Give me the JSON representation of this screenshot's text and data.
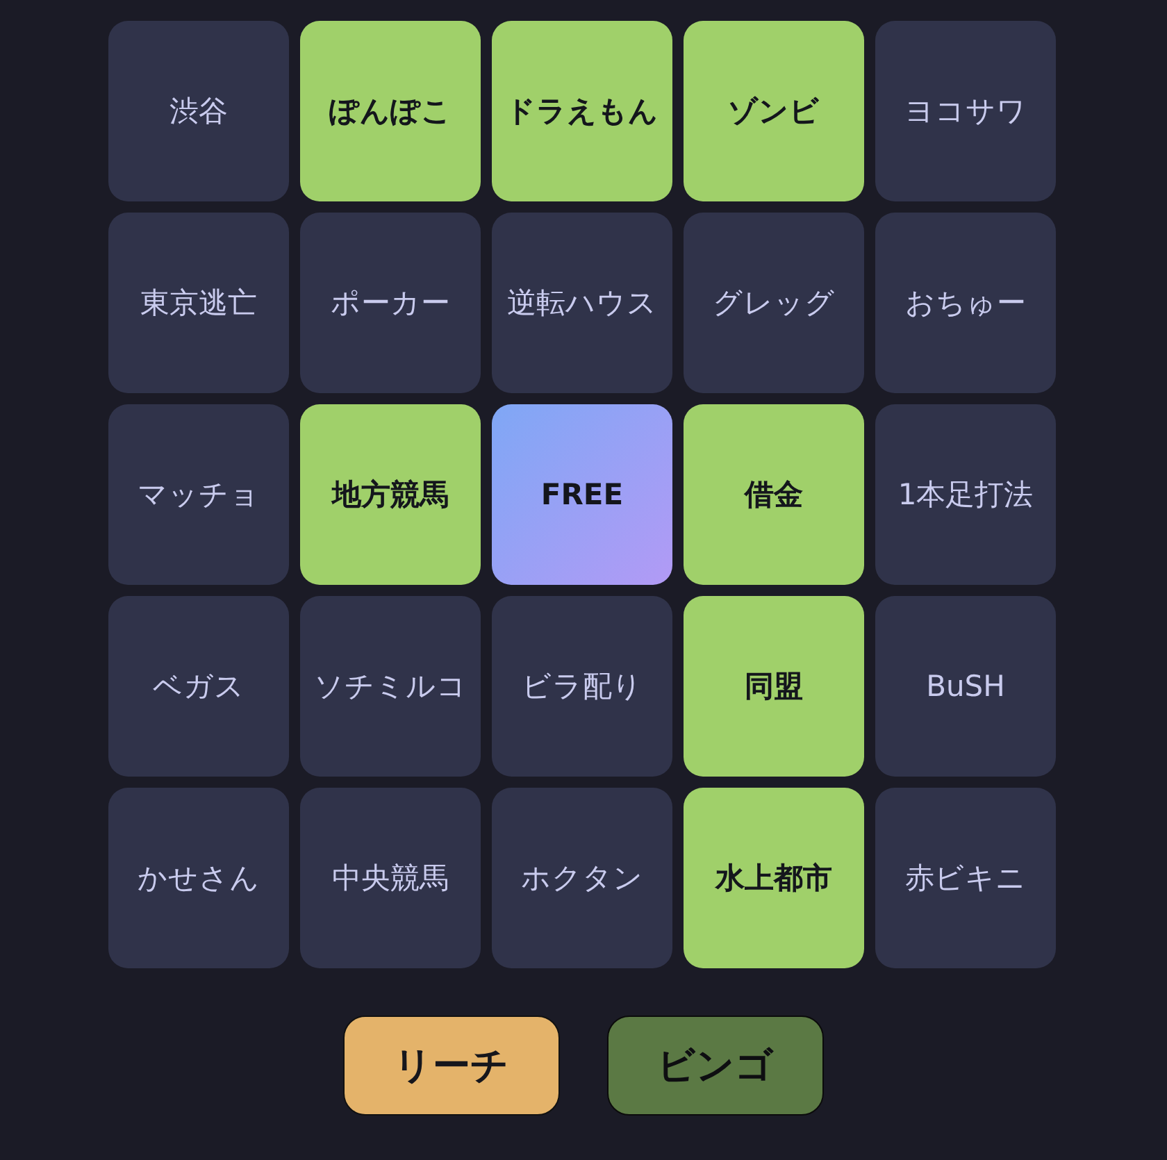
{
  "cells": [
    {
      "label": "渋谷",
      "selected": false,
      "kind": "word"
    },
    {
      "label": "ぽんぽこ",
      "selected": true,
      "kind": "word"
    },
    {
      "label": "ドラえもん",
      "selected": true,
      "kind": "word"
    },
    {
      "label": "ゾンビ",
      "selected": true,
      "kind": "word"
    },
    {
      "label": "ヨコサワ",
      "selected": false,
      "kind": "word"
    },
    {
      "label": "東京逃亡",
      "selected": false,
      "kind": "word"
    },
    {
      "label": "ポーカー",
      "selected": false,
      "kind": "word"
    },
    {
      "label": "逆転ハウス",
      "selected": false,
      "kind": "word"
    },
    {
      "label": "グレッグ",
      "selected": false,
      "kind": "word"
    },
    {
      "label": "おちゅー",
      "selected": false,
      "kind": "word"
    },
    {
      "label": "マッチョ",
      "selected": false,
      "kind": "word"
    },
    {
      "label": "地方競馬",
      "selected": true,
      "kind": "word"
    },
    {
      "label": "FREE",
      "selected": true,
      "kind": "free"
    },
    {
      "label": "借金",
      "selected": true,
      "kind": "word"
    },
    {
      "label": "1本足打法",
      "selected": false,
      "kind": "word"
    },
    {
      "label": "ベガス",
      "selected": false,
      "kind": "word"
    },
    {
      "label": "ソチミルコ",
      "selected": false,
      "kind": "word"
    },
    {
      "label": "ビラ配り",
      "selected": false,
      "kind": "word"
    },
    {
      "label": "同盟",
      "selected": true,
      "kind": "word"
    },
    {
      "label": "BuSH",
      "selected": false,
      "kind": "word"
    },
    {
      "label": "かせさん",
      "selected": false,
      "kind": "word"
    },
    {
      "label": "中央競馬",
      "selected": false,
      "kind": "word"
    },
    {
      "label": "ホクタン",
      "selected": false,
      "kind": "word"
    },
    {
      "label": "水上都市",
      "selected": true,
      "kind": "word"
    },
    {
      "label": "赤ビキニ",
      "selected": false,
      "kind": "word"
    }
  ],
  "buttons": [
    {
      "label": "リーチ",
      "kind": "reach",
      "disabled": false
    },
    {
      "label": "ビンゴ",
      "kind": "bingo",
      "disabled": true
    }
  ]
}
